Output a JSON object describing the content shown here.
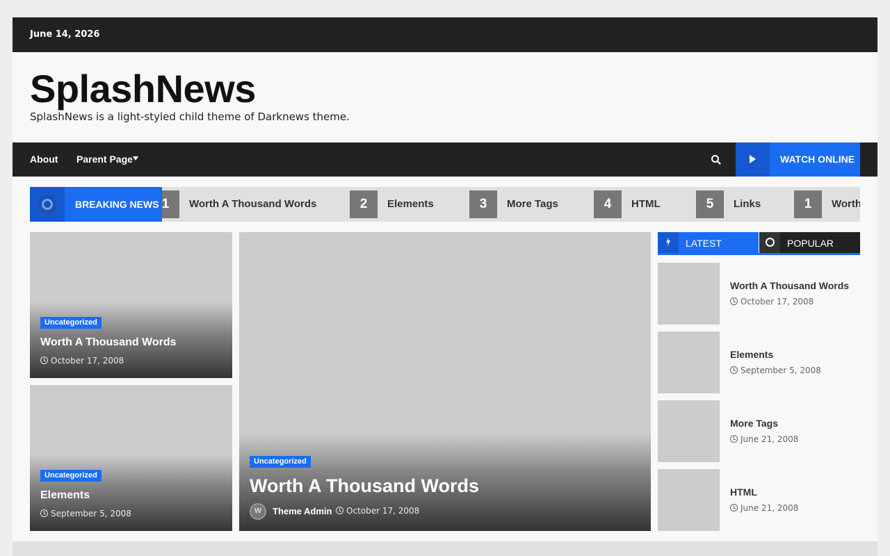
{
  "topbar": {
    "date": "June 14, 2026"
  },
  "header": {
    "site_title": "SplashNews",
    "site_description": "SplashNews is a light-styled child theme of Darknews theme."
  },
  "nav": {
    "items": [
      {
        "label": "About"
      },
      {
        "label": "Parent Page",
        "has_dropdown": true
      }
    ],
    "search_icon": "search-icon",
    "watch_label": "WATCH ONLINE"
  },
  "breaking": {
    "label": "BREAKING NEWS",
    "items": [
      {
        "num": "1",
        "title": "Worth A Thousand Words"
      },
      {
        "num": "2",
        "title": "Elements"
      },
      {
        "num": "3",
        "title": "More Tags"
      },
      {
        "num": "4",
        "title": "HTML"
      },
      {
        "num": "5",
        "title": "Links"
      },
      {
        "num": "1",
        "title": "Worth A Thousand Words"
      }
    ]
  },
  "cards": {
    "small1": {
      "category": "Uncategorized",
      "title": "Worth A Thousand Words",
      "date": "October 17, 2008"
    },
    "small2": {
      "category": "Uncategorized",
      "title": "Elements",
      "date": "September 5, 2008"
    },
    "featured": {
      "category": "Uncategorized",
      "title": "Worth A Thousand Words",
      "author": "Theme Admin",
      "date": "October 17, 2008"
    }
  },
  "sidebar": {
    "tab_latest": "LATEST",
    "tab_popular": "POPULAR",
    "items": [
      {
        "title": "Worth A Thousand Words",
        "date": "October 17, 2008"
      },
      {
        "title": "Elements",
        "date": "September 5, 2008"
      },
      {
        "title": "More Tags",
        "date": "June 21, 2008"
      },
      {
        "title": "HTML",
        "date": "June 21, 2008"
      }
    ]
  },
  "colors": {
    "accent": "#1a6df0",
    "dark": "#222222",
    "placeholder": "#cccccc"
  }
}
